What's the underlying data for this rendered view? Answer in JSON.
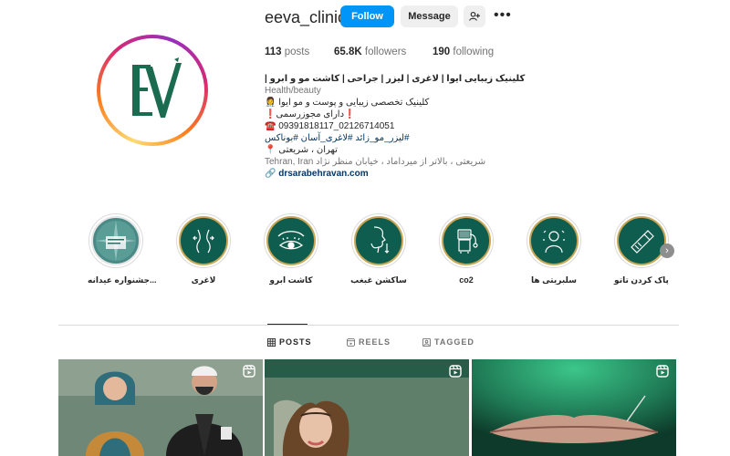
{
  "profile": {
    "username": "eeva_clinic",
    "follow_label": "Follow",
    "message_label": "Message",
    "stats": {
      "posts_count": "113",
      "posts_label": "posts",
      "followers_count": "65.8K",
      "followers_label": "followers",
      "following_count": "190",
      "following_label": "following"
    },
    "bio": {
      "title": "کلینیک زیبایی ایوا | لاغری | لیزر | جراحی | کاشت مو و ابرو |",
      "category": "Health/beauty",
      "line1": "کلینیک تخصصی زیبایی و پوست و مو ایوا 👩‍⚕️",
      "line2": "❗دارای مجوزرسمی❗",
      "phone": "☎️ 09391818117_02126714051",
      "hashtags": "#لیزر_مو_زائد #لاغری_آسان #بوناکس",
      "location": "تهران ، شریعتی 📍",
      "address": "Tehran, Iran شریعتی ، بالاتر از میرداماد ، خیابان منظر نژاد",
      "link": "drsarabehravan.com"
    }
  },
  "highlights": [
    {
      "label": "جشنواره عیدانه...",
      "icon": "festival-image"
    },
    {
      "label": "لاغری",
      "icon": "waist-icon"
    },
    {
      "label": "کاشت ابرو",
      "icon": "eyebrow-icon"
    },
    {
      "label": "ساکشن غبغب",
      "icon": "face-profile-icon"
    },
    {
      "label": "co2",
      "icon": "laser-device-icon"
    },
    {
      "label": "سلبریتی ها",
      "icon": "celebrity-icon"
    },
    {
      "label": "پاک کردن تاتو",
      "icon": "tattoo-removal-icon"
    }
  ],
  "tabs": [
    {
      "label": "POSTS",
      "active": true,
      "icon": "grid-icon"
    },
    {
      "label": "REELS",
      "active": false,
      "icon": "reels-icon"
    },
    {
      "label": "TAGGED",
      "active": false,
      "icon": "tagged-icon"
    }
  ],
  "colors": {
    "follow_button": "#0095f6",
    "highlight_bg": "#0e5d4e",
    "highlight_border": "#c9a655",
    "link": "#00376b"
  }
}
